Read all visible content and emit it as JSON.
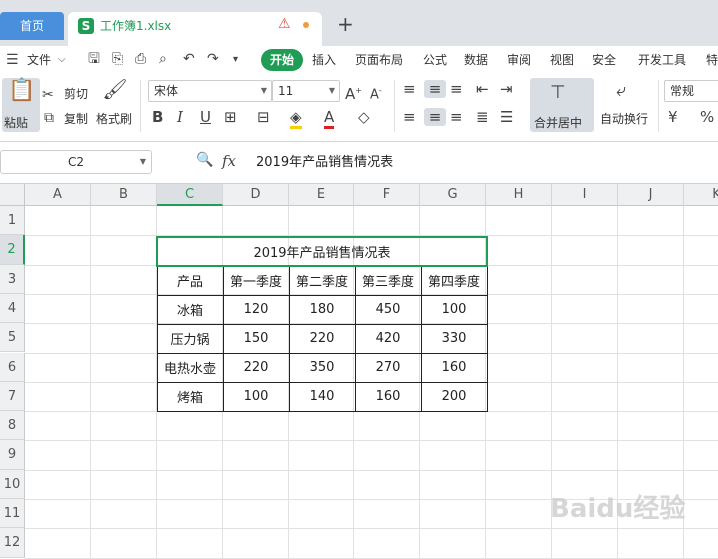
{
  "tabs": {
    "home": "首页",
    "file": "工作簿1.xlsx"
  },
  "menu": {
    "file_label": "文件",
    "items": [
      "开始",
      "插入",
      "页面布局",
      "公式",
      "数据",
      "审阅",
      "视图",
      "安全",
      "开发工具",
      "特"
    ]
  },
  "ribbon": {
    "paste": "粘贴",
    "cut": "剪切",
    "copy": "复制",
    "format_painter": "格式刷",
    "font_name": "宋体",
    "font_size": "11",
    "merge_center": "合并居中",
    "wrap_text": "自动换行",
    "number_format": "常规"
  },
  "formula_bar": {
    "cell_ref": "C2",
    "fx": "fx",
    "content": "2019年产品销售情况表"
  },
  "columns": [
    "A",
    "B",
    "C",
    "D",
    "E",
    "F",
    "G",
    "H",
    "I",
    "J",
    "K"
  ],
  "rows": [
    "1",
    "2",
    "3",
    "4",
    "5",
    "6",
    "7",
    "8",
    "9",
    "10",
    "11",
    "12"
  ],
  "table": {
    "title": "2019年产品销售情况表",
    "headers": [
      "产品",
      "第一季度",
      "第二季度",
      "第三季度",
      "第四季度"
    ],
    "rows": [
      [
        "冰箱",
        "120",
        "180",
        "450",
        "100"
      ],
      [
        "压力锅",
        "150",
        "220",
        "420",
        "330"
      ],
      [
        "电热水壶",
        "220",
        "350",
        "270",
        "160"
      ],
      [
        "烤箱",
        "100",
        "140",
        "160",
        "200"
      ]
    ]
  },
  "watermark": "Baidu经验",
  "colors": {
    "accent": "#1f9d55",
    "tab_blue": "#4a8fdb"
  }
}
